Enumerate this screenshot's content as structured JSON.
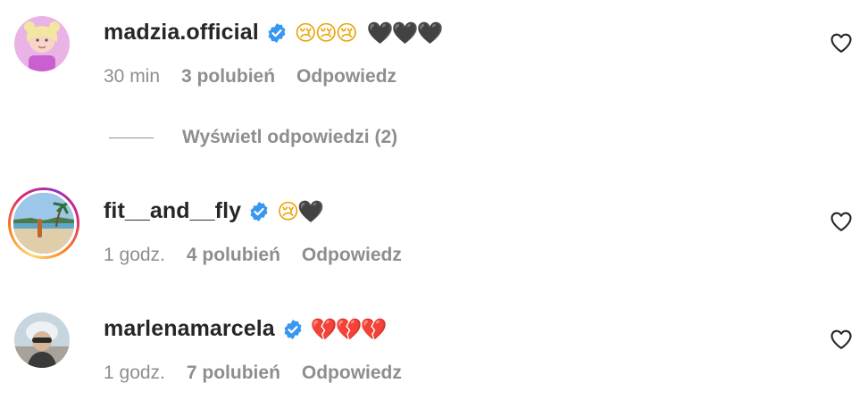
{
  "comments": [
    {
      "username": "madzia.official",
      "verified": true,
      "emoji_sad": "😢😢😢",
      "emoji_heart": "🖤🖤🖤",
      "time": "30 min",
      "likes": "3 polubień",
      "reply": "Odpowiedz",
      "avatar_icon": "avatar-madzia",
      "has_story": false
    },
    {
      "username": "fit__and__fly",
      "verified": true,
      "emoji_sad": "😢",
      "emoji_heart": "🖤",
      "time": "1 godz.",
      "likes": "4 polubień",
      "reply": "Odpowiedz",
      "avatar_icon": "avatar-beach",
      "has_story": true
    },
    {
      "username": "marlenamarcela",
      "verified": true,
      "emoji_sad": "",
      "emoji_heart": "💔💔💔",
      "time": "1 godz.",
      "likes": "7 polubień",
      "reply": "Odpowiedz",
      "avatar_icon": "avatar-marlena",
      "has_story": false
    }
  ],
  "view_replies": "Wyświetl odpowiedzi (2)",
  "colors": {
    "text": "#262626",
    "secondary": "#8e8e8e",
    "verified": "#3897f0"
  }
}
